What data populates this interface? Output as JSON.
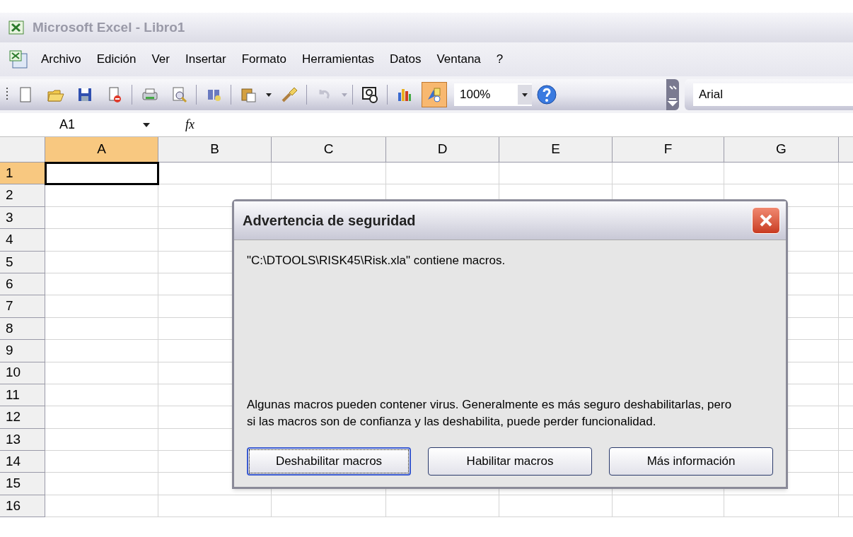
{
  "window": {
    "title": "Microsoft Excel - Libro1"
  },
  "menu": [
    "Archivo",
    "Edición",
    "Ver",
    "Insertar",
    "Formato",
    "Herramientas",
    "Datos",
    "Ventana",
    "?"
  ],
  "toolbar": {
    "items": [
      {
        "kind": "button",
        "selected": false,
        "disabled": false
      },
      {
        "kind": "button",
        "selected": false,
        "disabled": false
      },
      {
        "kind": "button",
        "selected": false,
        "disabled": false
      },
      {
        "kind": "button",
        "selected": false,
        "disabled": false
      },
      {
        "kind": "separator"
      },
      {
        "kind": "button",
        "selected": false,
        "disabled": false
      },
      {
        "kind": "button",
        "selected": false,
        "disabled": false
      },
      {
        "kind": "separator"
      },
      {
        "kind": "button",
        "selected": false,
        "disabled": false
      },
      {
        "kind": "separator"
      },
      {
        "kind": "button",
        "selected": false,
        "disabled": false
      },
      {
        "kind": "arrow",
        "disabled": false
      },
      {
        "kind": "button",
        "selected": false,
        "disabled": false
      },
      {
        "kind": "separator"
      },
      {
        "kind": "button",
        "selected": false,
        "disabled": true
      },
      {
        "kind": "arrow",
        "disabled": true
      },
      {
        "kind": "separator"
      },
      {
        "kind": "button",
        "selected": false,
        "disabled": false
      },
      {
        "kind": "separator"
      },
      {
        "kind": "button",
        "selected": false,
        "disabled": false
      },
      {
        "kind": "button",
        "selected": true,
        "disabled": false
      }
    ],
    "zoom": "100%",
    "font": "Arial"
  },
  "formula_bar": {
    "name_box": "A1",
    "function_label": "fx"
  },
  "sheet": {
    "columns": [
      {
        "label": "A",
        "selected": true
      },
      {
        "label": "B",
        "selected": false
      },
      {
        "label": "C",
        "selected": false
      },
      {
        "label": "D",
        "selected": false
      },
      {
        "label": "E",
        "selected": false
      },
      {
        "label": "F",
        "selected": false
      },
      {
        "label": "G",
        "selected": false
      }
    ],
    "rows": [
      {
        "label": "1",
        "selected": true
      },
      {
        "label": "2",
        "selected": false
      },
      {
        "label": "3",
        "selected": false
      },
      {
        "label": "4",
        "selected": false
      },
      {
        "label": "5",
        "selected": false
      },
      {
        "label": "6",
        "selected": false
      },
      {
        "label": "7",
        "selected": false
      },
      {
        "label": "8",
        "selected": false
      },
      {
        "label": "9",
        "selected": false
      },
      {
        "label": "10",
        "selected": false
      },
      {
        "label": "11",
        "selected": false
      },
      {
        "label": "12",
        "selected": false
      },
      {
        "label": "13",
        "selected": false
      },
      {
        "label": "14",
        "selected": false
      },
      {
        "label": "15",
        "selected": false
      },
      {
        "label": "16",
        "selected": false
      }
    ]
  },
  "dialog": {
    "title": "Advertencia de seguridad",
    "message": "\"C:\\DTOOLS\\RISK45\\Risk.xla\" contiene macros.",
    "warning": "Algunas macros pueden contener virus. Generalmente es más seguro deshabilitarlas, pero si las macros son de confianza y las deshabilita, puede perder funcionalidad.",
    "buttons": [
      {
        "label": "Deshabilitar macros",
        "selected": true
      },
      {
        "label": "Habilitar macros",
        "selected": false
      },
      {
        "label": "Más información",
        "selected": false
      }
    ]
  }
}
